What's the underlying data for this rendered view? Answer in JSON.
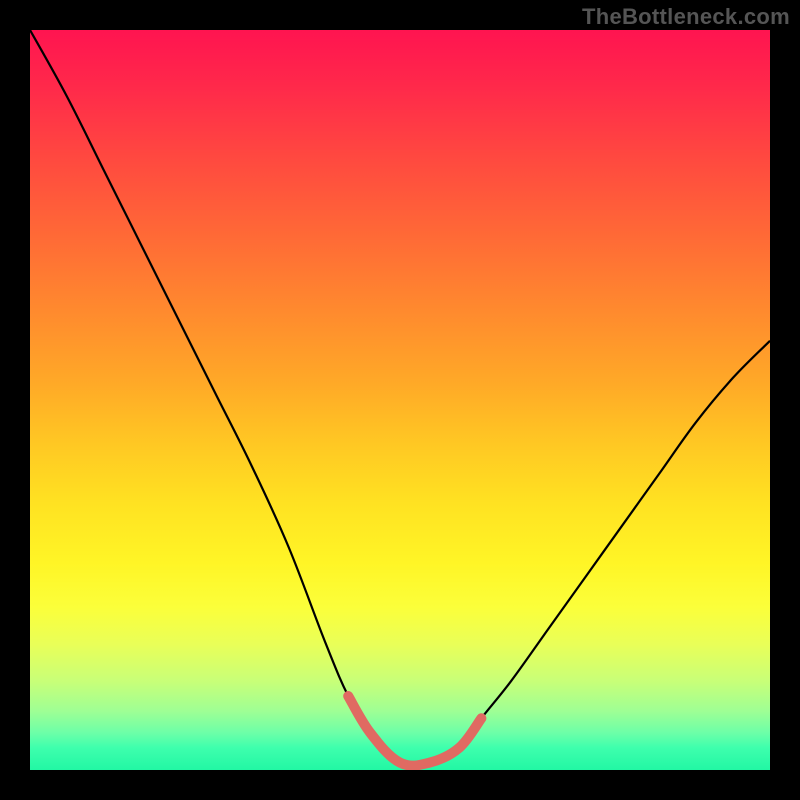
{
  "watermark": "TheBottleneck.com",
  "colors": {
    "frame": "#000000",
    "curve": "#000000",
    "trough": "#e06a62",
    "gradient_top": "#ff1450",
    "gradient_bottom": "#22f7a4"
  },
  "chart_data": {
    "type": "line",
    "title": "",
    "xlabel": "",
    "ylabel": "",
    "xlim": [
      0,
      100
    ],
    "ylim": [
      0,
      100
    ],
    "grid": false,
    "legend": false,
    "series": [
      {
        "name": "bottleneck-curve",
        "x": [
          0,
          5,
          10,
          15,
          20,
          25,
          30,
          35,
          40,
          43,
          46,
          50,
          54,
          58,
          61,
          65,
          70,
          75,
          80,
          85,
          90,
          95,
          100
        ],
        "values": [
          100,
          91,
          81,
          71,
          61,
          51,
          41,
          30,
          17,
          10,
          5,
          1,
          1,
          3,
          7,
          12,
          19,
          26,
          33,
          40,
          47,
          53,
          58
        ]
      }
    ],
    "trough_range_x": [
      43,
      61
    ],
    "annotations": []
  }
}
